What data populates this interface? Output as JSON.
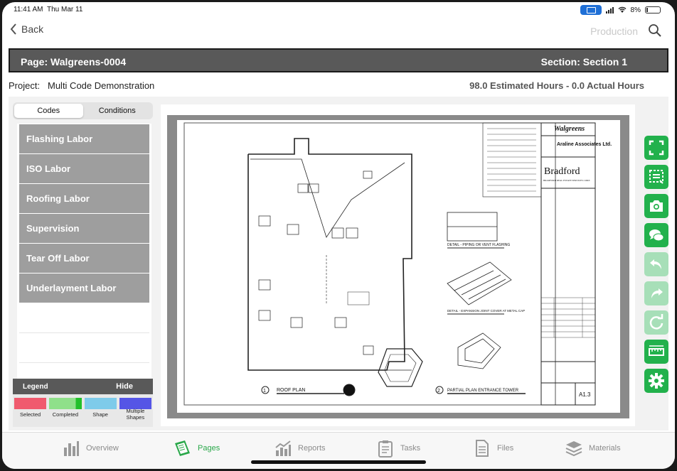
{
  "status_bar": {
    "time": "11:41 AM",
    "date": "Thu Mar 11",
    "battery": "8%"
  },
  "nav": {
    "back_label": "Back",
    "right_label": "Production"
  },
  "page": {
    "name": "Page: Walgreens-0004",
    "section": "Section: Section 1"
  },
  "project": {
    "label": "Project:",
    "name": "Multi Code Demonstration",
    "hours": "98.0 Estimated Hours - 0.0 Actual Hours"
  },
  "segments": {
    "codes": "Codes",
    "conditions": "Conditions"
  },
  "codes": [
    {
      "label": "Flashing Labor"
    },
    {
      "label": "ISO Labor"
    },
    {
      "label": "Roofing Labor"
    },
    {
      "label": "Supervision"
    },
    {
      "label": "Tear Off Labor"
    },
    {
      "label": "Underlayment Labor"
    }
  ],
  "legend": {
    "title": "Legend",
    "hide_label": "Hide",
    "items": [
      {
        "label": "Selected",
        "color": "#f05a6e"
      },
      {
        "label": "Completed",
        "color": "#8fe08a"
      },
      {
        "label": "Shape",
        "color": "#7ecbea"
      },
      {
        "label": "Multiple Shapes",
        "color": "#5555e6"
      }
    ]
  },
  "drawing": {
    "brand": "Walgreens",
    "firm": "Araline Associates Ltd.",
    "client": "Bradford",
    "client_sub": "BRADFORD REAL ESTATE SERVICES CORP.",
    "roof_plan_title": "ROOF PLAN",
    "tower_title": "PARTIAL PLAN ENTRANCE TOWER",
    "detail_1": "DETAIL - PIPING OR VENT FLASHING",
    "detail_2": "DETAIL - EXPANSION JOINT COVER AT METAL CAP",
    "sheet_number": "A1.3",
    "marker_1": "1",
    "marker_2": "2"
  },
  "tools": [
    "fullscreen-icon",
    "selection-icon",
    "camera-icon",
    "chat-icon",
    "undo-icon",
    "redo-icon",
    "refresh-icon",
    "ruler-icon",
    "gear-icon"
  ],
  "tabs": [
    {
      "label": "Overview",
      "icon": "bar-chart-icon",
      "active": false
    },
    {
      "label": "Pages",
      "icon": "pages-icon",
      "active": true
    },
    {
      "label": "Reports",
      "icon": "reports-icon",
      "active": false
    },
    {
      "label": "Tasks",
      "icon": "clipboard-icon",
      "active": false
    },
    {
      "label": "Files",
      "icon": "files-icon",
      "active": false
    },
    {
      "label": "Materials",
      "icon": "layers-icon",
      "active": false
    }
  ],
  "colors": {
    "accent": "#22b14c",
    "header_bg": "#595959",
    "code_bg": "#9e9e9e"
  }
}
